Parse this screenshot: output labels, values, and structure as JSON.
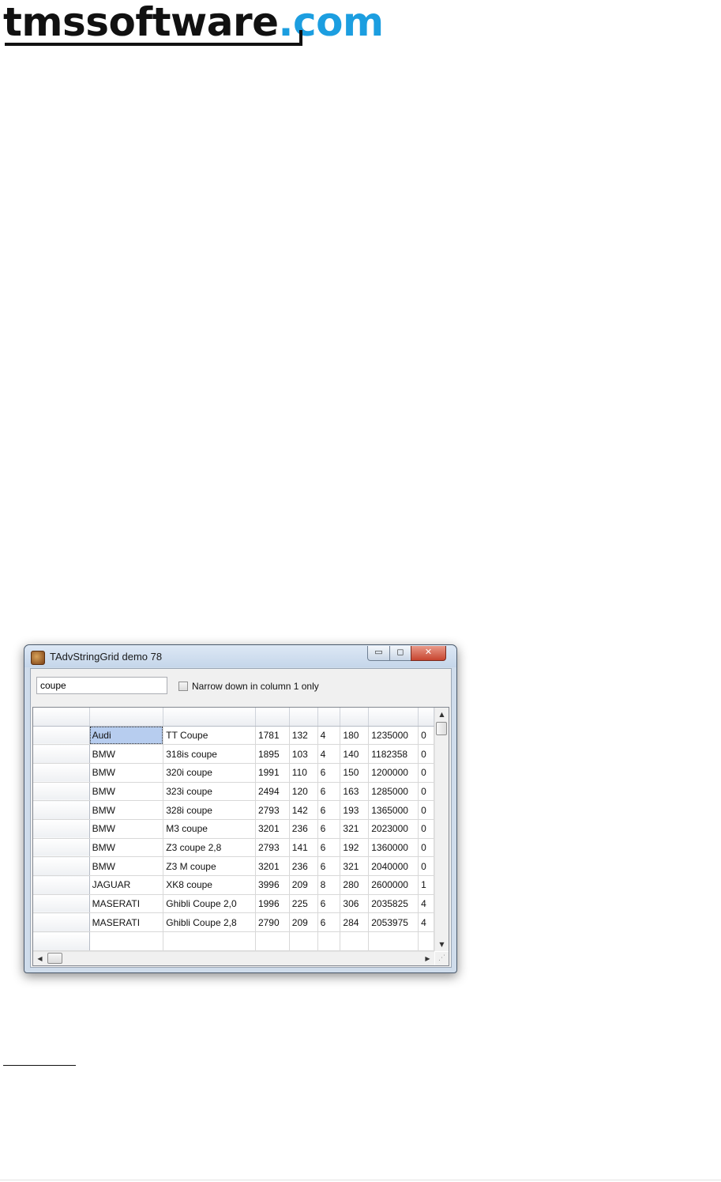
{
  "logo": {
    "main": "tmssoftware",
    "dot": ".",
    "tld": "com"
  },
  "window": {
    "title": "TAdvStringGrid demo 78",
    "min_glyph": "▭",
    "max_glyph": "◻",
    "close_glyph": "✕"
  },
  "search": {
    "value": "coupe"
  },
  "narrow_checkbox": {
    "label": "Narrow down in column 1 only",
    "checked": false
  },
  "grid": {
    "rows": [
      [
        "Audi",
        "TT Coupe",
        "1781",
        "132",
        "4",
        "180",
        "1235000",
        "0"
      ],
      [
        "BMW",
        "318is coupe",
        "1895",
        "103",
        "4",
        "140",
        "1182358",
        "0"
      ],
      [
        "BMW",
        "320i coupe",
        "1991",
        "110",
        "6",
        "150",
        "1200000",
        "0"
      ],
      [
        "BMW",
        "323i coupe",
        "2494",
        "120",
        "6",
        "163",
        "1285000",
        "0"
      ],
      [
        "BMW",
        "328i coupe",
        "2793",
        "142",
        "6",
        "193",
        "1365000",
        "0"
      ],
      [
        "BMW",
        "M3 coupe",
        "3201",
        "236",
        "6",
        "321",
        "2023000",
        "0"
      ],
      [
        "BMW",
        "Z3 coupe 2,8",
        "2793",
        "141",
        "6",
        "192",
        "1360000",
        "0"
      ],
      [
        "BMW",
        "Z3 M coupe",
        "3201",
        "236",
        "6",
        "321",
        "2040000",
        "0"
      ],
      [
        "JAGUAR",
        "XK8 coupe",
        "3996",
        "209",
        "8",
        "280",
        "2600000",
        "1"
      ],
      [
        "MASERATI",
        "Ghibli Coupe 2,0",
        "1996",
        "225",
        "6",
        "306",
        "2035825",
        "4"
      ],
      [
        "MASERATI",
        "Ghibli Coupe 2,8",
        "2790",
        "209",
        "6",
        "284",
        "2053975",
        "4"
      ]
    ],
    "selected_cell": "Audi"
  },
  "scrollbar": {
    "up": "▲",
    "down": "▼",
    "left": "◀",
    "right": "▶",
    "grip": "⋰"
  },
  "colors": {
    "brand_blue": "#1c9ee0",
    "selection": "#b7cdef",
    "titlebar": "#cfdceb",
    "close_red": "#c74530"
  }
}
